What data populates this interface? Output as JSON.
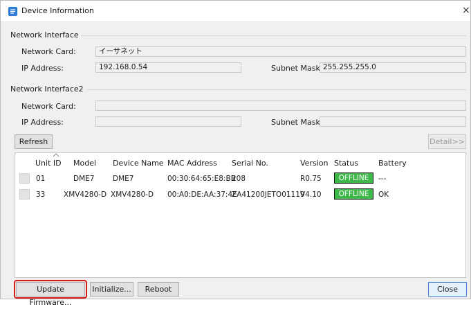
{
  "window": {
    "title": "Device Information",
    "close_glyph": "×"
  },
  "network_interface": {
    "group_title": "Network Interface",
    "network_card_label": "Network Card:",
    "network_card_value": "イーサネット",
    "ip_label": "IP Address:",
    "ip_value": "192.168.0.54",
    "subnet_label": "Subnet Mask:",
    "subnet_value": "255.255.255.0"
  },
  "network_interface2": {
    "group_title": "Network Interface2",
    "network_card_label": "Network Card:",
    "network_card_value": "",
    "ip_label": "IP Address:",
    "ip_value": "",
    "subnet_label": "Subnet Mask:",
    "subnet_value": ""
  },
  "toolbar": {
    "refresh_label": "Refresh",
    "detail_label": "Detail>>"
  },
  "table": {
    "columns": [
      "Unit ID",
      "Model",
      "Device Name",
      "MAC Address",
      "Serial No.",
      "Version",
      "Status",
      "Battery"
    ],
    "rows": [
      {
        "unit_id": "01",
        "model": "DME7",
        "device_name": "DME7",
        "mac": "00:30:64:65:E8:BB",
        "serial": "208",
        "version": "R0.75",
        "status": "OFFLINE",
        "battery": "---"
      },
      {
        "unit_id": "33",
        "model": "XMV4280-D",
        "device_name": "XMV4280-D",
        "mac": "00:A0:DE:AA:37:4E",
        "serial": "ZA41200JETO01119",
        "version": "V4.10",
        "status": "OFFLINE",
        "battery": "OK"
      }
    ]
  },
  "footer": {
    "update_firmware_label": "Update Firmware...",
    "initialize_label": "Initialize...",
    "reboot_label": "Reboot",
    "close_label": "Close"
  },
  "colors": {
    "status_offline": "#3fb84a",
    "highlight": "#d61a1a",
    "title_icon": "#2b7bd6"
  },
  "icons": {
    "app": "device-info-app-icon",
    "close": "close-icon",
    "sort": "sort-arrow-icon"
  }
}
